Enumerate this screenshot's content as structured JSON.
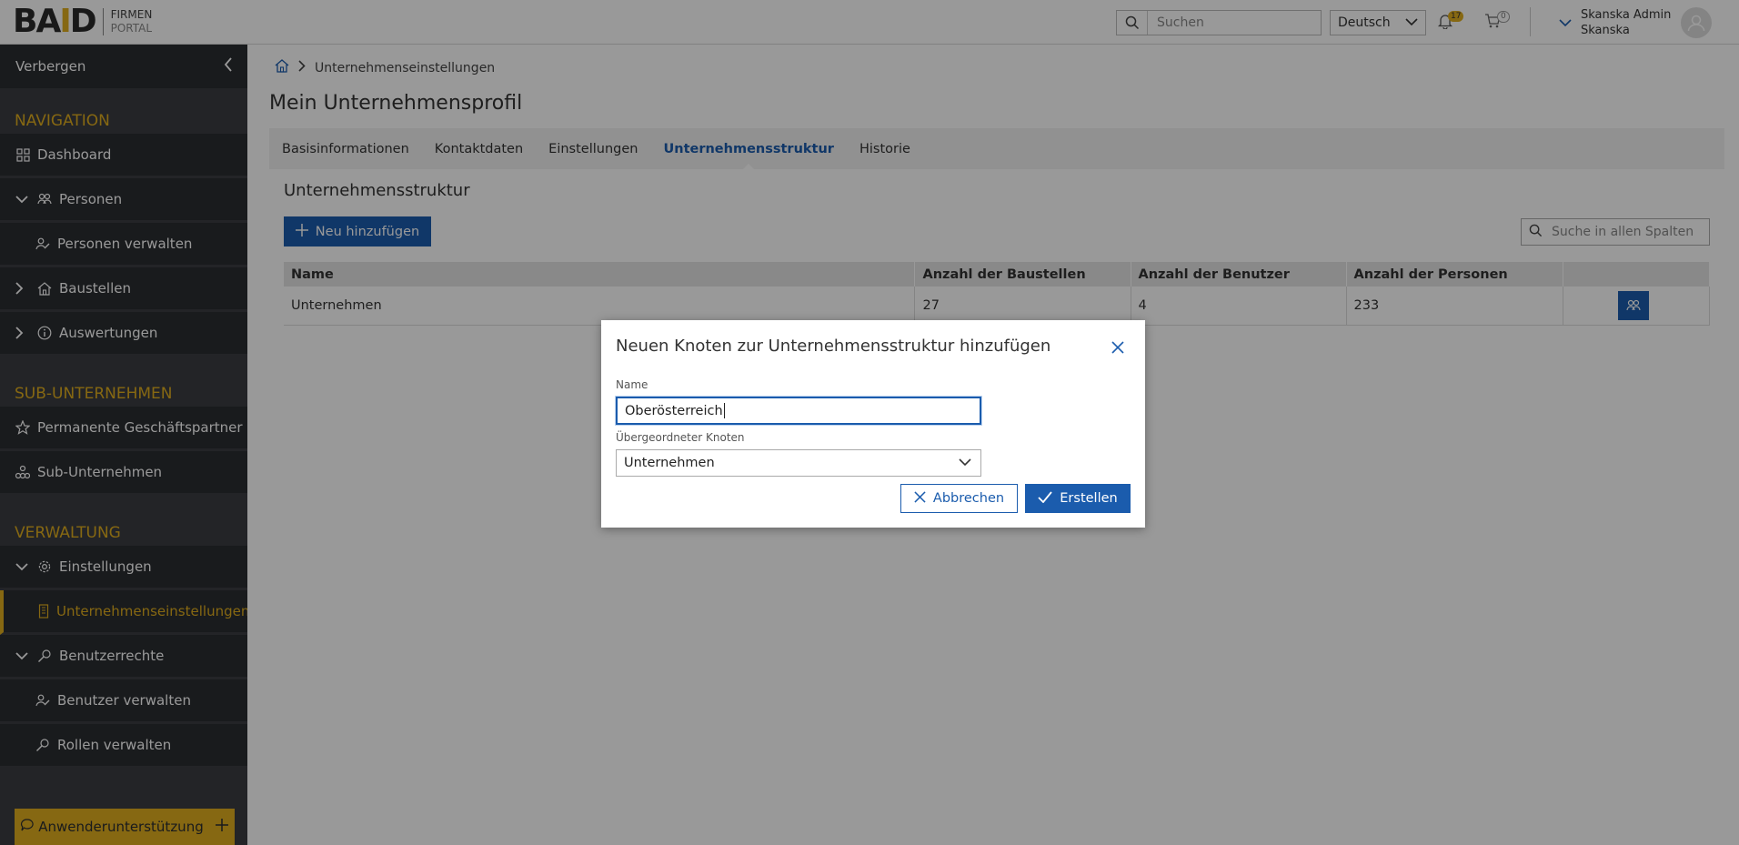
{
  "header": {
    "logo_main": "BA",
    "logo_accent": "I",
    "logo_end": "D",
    "logo_sub1": "FIRMEN",
    "logo_sub2": "PORTAL",
    "search_placeholder": "Suchen",
    "language": "Deutsch",
    "notifications_count": "17",
    "cart_count": "0",
    "user_name": "Skanska Admin",
    "user_company": "Skanska"
  },
  "sidebar": {
    "hide_label": "Verbergen",
    "sections": {
      "navigation": "NAVIGATION",
      "sub": "SUB-UNTERNEHMEN",
      "admin": "VERWALTUNG"
    },
    "items": {
      "dashboard": "Dashboard",
      "personen": "Personen",
      "personen_verwalten": "Personen verwalten",
      "baustellen": "Baustellen",
      "auswertungen": "Auswertungen",
      "geschaeftspartner": "Permanente Geschäftspartner",
      "sub_unternehmen": "Sub-Unternehmen",
      "einstellungen": "Einstellungen",
      "unternehmenseinstellungen": "Unternehmenseinstellungen",
      "benutzerrechte": "Benutzerrechte",
      "benutzer_verwalten": "Benutzer verwalten",
      "rollen_verwalten": "Rollen verwalten"
    },
    "support_label": "Anwenderunterstützung"
  },
  "main": {
    "breadcrumb_current": "Unternehmenseinstellungen",
    "page_title": "Mein Unternehmensprofil",
    "tabs": [
      "Basisinformationen",
      "Kontaktdaten",
      "Einstellungen",
      "Unternehmensstruktur",
      "Historie"
    ],
    "active_tab": "Unternehmensstruktur",
    "section_title": "Unternehmensstruktur",
    "new_button": "Neu hinzufügen",
    "table_search_placeholder": "Suche in allen Spalten",
    "table": {
      "headers": [
        "Name",
        "Anzahl der Baustellen",
        "Anzahl der Benutzer",
        "Anzahl der Personen"
      ],
      "rows": [
        [
          "Unternehmen",
          "27",
          "4",
          "233"
        ]
      ]
    }
  },
  "dialog": {
    "title": "Neuen Knoten zur Unternehmensstruktur hinzufügen",
    "name_label": "Name",
    "name_value": "Oberösterreich",
    "parent_label": "Übergeordneter Knoten",
    "parent_value": "Unternehmen",
    "cancel_label": "Abbrechen",
    "create_label": "Erstellen"
  },
  "colors": {
    "primary": "#1b5cad",
    "accent": "#e0ad1e",
    "sidebar_bg": "#3b3d42",
    "sidebar_item_bg": "#2b2d31"
  }
}
